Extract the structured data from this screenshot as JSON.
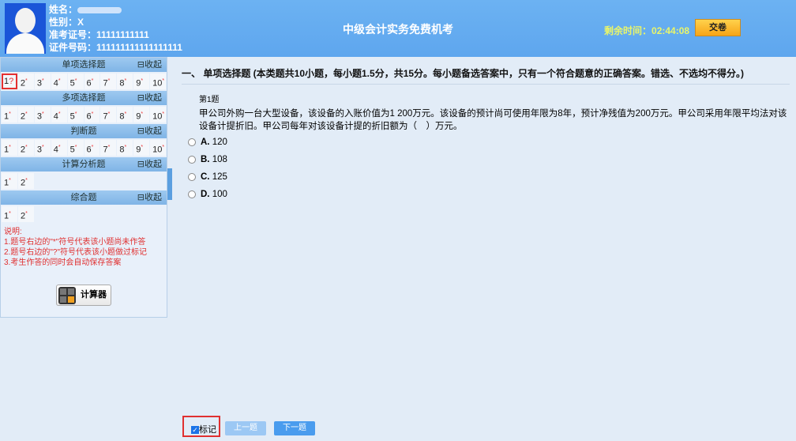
{
  "header": {
    "name_label": "姓名：",
    "gender_label": "性别：",
    "gender": "X",
    "exam_no_label": "准考证号：",
    "exam_no": "11111111111",
    "id_label": "证件号码：",
    "id_no": "111111111111111111",
    "title": "中级会计实务免费机考",
    "time_label": "剩余时间：",
    "time": "02:44:08",
    "submit": "交卷"
  },
  "sidebar": {
    "collapse": "⊟收起",
    "sections": [
      {
        "title": "单项选择题",
        "count": 10
      },
      {
        "title": "多项选择题",
        "count": 10
      },
      {
        "title": "判断题",
        "count": 10
      },
      {
        "title": "计算分析题",
        "count": 2
      },
      {
        "title": "综合题",
        "count": 2
      }
    ],
    "current_mark": "?",
    "unanswered_mark": "*",
    "notes": [
      "说明:",
      "1.题号右边的\"*\"符号代表该小题尚未作答",
      "2.题号右边的\"?\"符号代表该小题做过标记",
      "3.考生作答的同时会自动保存答案"
    ],
    "calculator": "计算器"
  },
  "main": {
    "section_title": "一、 单项选择题 (本类题共10小题，每小题1.5分，共15分。每小题备选答案中，只有一个符合题意的正确答案。错选、不选均不得分。)",
    "question_no": "第1题",
    "stem": "甲公司外购一台大型设备，该设备的入账价值为1 200万元。该设备的预计尚可使用年限为8年，预计净残值为200万元。甲公司采用年限平均法对该设备计提折旧。甲公司每年对该设备计提的折旧额为（　）万元。",
    "options": [
      {
        "key": "A.",
        "text": "120"
      },
      {
        "key": "B.",
        "text": "108"
      },
      {
        "key": "C.",
        "text": "125"
      },
      {
        "key": "D.",
        "text": "100"
      }
    ],
    "mark_label": "标记",
    "prev": "上一题",
    "next": "下一题"
  }
}
